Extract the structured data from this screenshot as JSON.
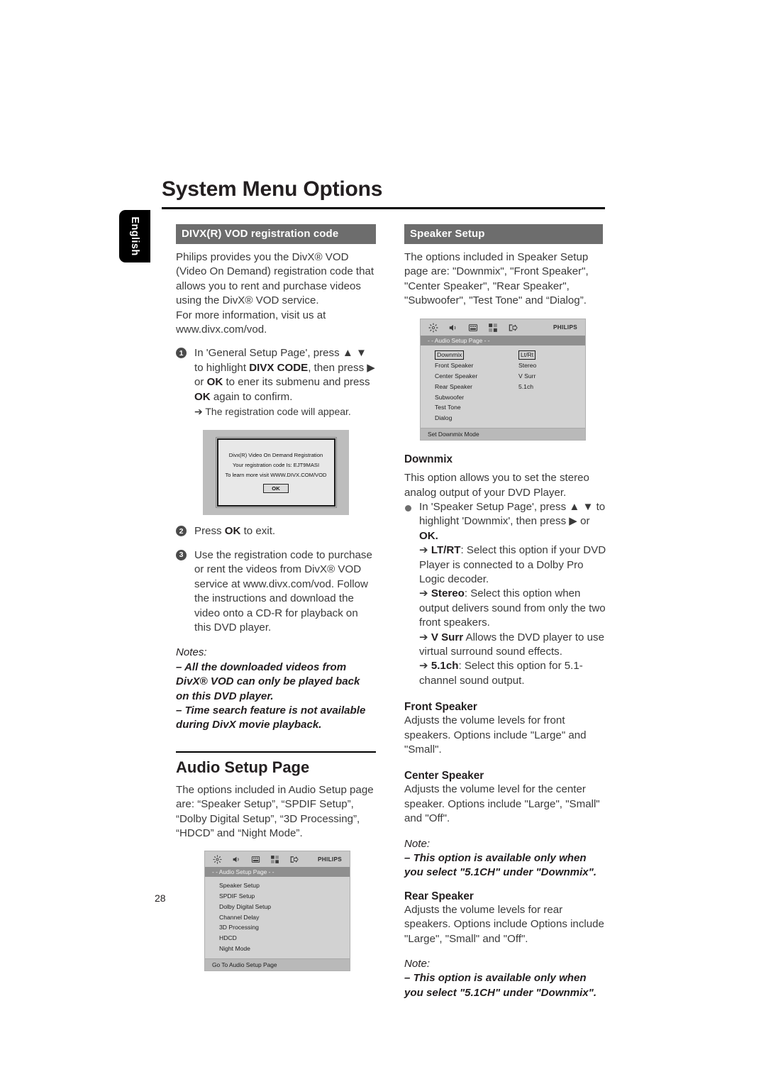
{
  "page": {
    "title": "System Menu Options",
    "number": "28",
    "side_tab": "English"
  },
  "left_column": {
    "band_title": "DIVX(R) VOD registration code",
    "intro": "Philips provides you the DivX® VOD (Video On Demand) registration code that allows you to rent and purchase videos using the DivX® VOD service.",
    "intro2": "For more information, visit us at www.divx.com/vod.",
    "step1": {
      "num": "1",
      "line1": "In 'General Setup Page', press ▲ ▼ to highlight",
      "bold1": "DIVX CODE",
      "line2": ", then press ▶ or ",
      "bold2": "OK",
      "line3": " to ener its submenu and press ",
      "bold3": "OK",
      "line4": " again to confirm.",
      "result": "➔ The registration code will appear."
    },
    "divx_dialog": {
      "line1": "Divx(R) Video On Demand Registration",
      "line2": "Your registration code Is: EJT9MASI",
      "line3": "To learn more visit WWW.DIVX.COM/VOD",
      "ok": "OK"
    },
    "step2": {
      "num": "2",
      "text_pre": "Press ",
      "bold": "OK",
      "text_post": " to exit."
    },
    "step3": {
      "num": "3",
      "text": "Use the registration code to purchase or rent the videos from DivX® VOD service at www.divx.com/vod. Follow the instructions and download the video onto a CD-R for playback on this DVD player."
    },
    "notes_heading": "Notes:",
    "note1": "–   All the downloaded videos from DivX® VOD can only be played back on this DVD player.",
    "note2": "–   Time search feature is not available during DivX movie playback.",
    "audio_setup": {
      "title": "Audio Setup Page",
      "body": "The options included in Audio Setup page are: “Speaker Setup”, “SPDIF Setup”, “Dolby Digital Setup”, “3D Processing”, “HDCD” and “Night Mode”."
    }
  },
  "osd_audio_setup": {
    "brand": "PHILIPS",
    "page_bar": "- -  Audio  Setup  Page  - -",
    "items": [
      "Speaker Setup",
      "SPDIF Setup",
      "Dolby Digital Setup",
      "Channel Delay",
      "3D Processing",
      "HDCD",
      "Night Mode"
    ],
    "footer": "Go To Audio Setup Page",
    "icons": [
      "gear-icon",
      "speaker-icon",
      "video-icon",
      "preference-icon",
      "exit-icon"
    ]
  },
  "osd_speaker_setup": {
    "brand": "PHILIPS",
    "page_bar": "- -  Audio  Setup  Page  - -",
    "items": [
      "Downmix",
      "Front Speaker",
      "Center Speaker",
      "Rear Speaker",
      "Subwoofer",
      "Test Tone",
      "Dialog"
    ],
    "values": [
      "Lt/Rt",
      "Stereo",
      "V Surr",
      "5.1ch",
      "",
      "",
      ""
    ],
    "selected_item": "Downmix",
    "selected_value": "Lt/Rt",
    "footer": "Set Downmix Mode",
    "icons": [
      "gear-icon",
      "speaker-icon",
      "video-icon",
      "preference-icon",
      "exit-icon"
    ]
  },
  "right_column": {
    "band_title": "Speaker Setup",
    "intro": "The options included in Speaker Setup page are: \"Downmix\", \"Front Speaker\", \"Center Speaker\", \"Rear Speaker\", \"Subwoofer\", \"Test Tone\" and “Dialog”.",
    "downmix": {
      "heading": "Downmix",
      "body": "This option allows you to set the stereo analog output of your DVD Player.",
      "bullet_1": "In 'Speaker Setup Page', press ▲ ▼ to highlight 'Downmix', then press ▶ or ",
      "bullet_1_bold": "OK.",
      "opt_ltrt_label": "LT/RT",
      "opt_ltrt_text": ": Select this option if your DVD Player is connected to a Dolby Pro Logic decoder.",
      "opt_stereo_label": "Stereo",
      "opt_stereo_text": ": Select this option when output delivers sound from only the two front speakers.",
      "opt_vsurr_label": "V Surr",
      "opt_vsurr_text": " Allows the DVD player to use virtual surround sound effects.",
      "opt_51_label": "5.1ch",
      "opt_51_text": ": Select this option for 5.1-channel sound output."
    },
    "front_speaker": {
      "heading": "Front Speaker",
      "body": "Adjusts the volume levels for front speakers. Options include \"Large\" and \"Small\"."
    },
    "center_speaker": {
      "heading": "Center Speaker",
      "body": "Adjusts the volume level for the center speaker. Options include \"Large\", \"Small\" and \"Off\".",
      "note_heading": "Note:",
      "note": "–   This option is available only when you select \"5.1CH\" under \"Downmix\"."
    },
    "rear_speaker": {
      "heading": "Rear Speaker",
      "body": "Adjusts the volume levels for rear speakers. Options include Options include \"Large\", \"Small\" and \"Off\".",
      "note_heading": "Note:",
      "note": "–   This option is available only when you select \"5.1CH\" under \"Downmix\"."
    }
  }
}
